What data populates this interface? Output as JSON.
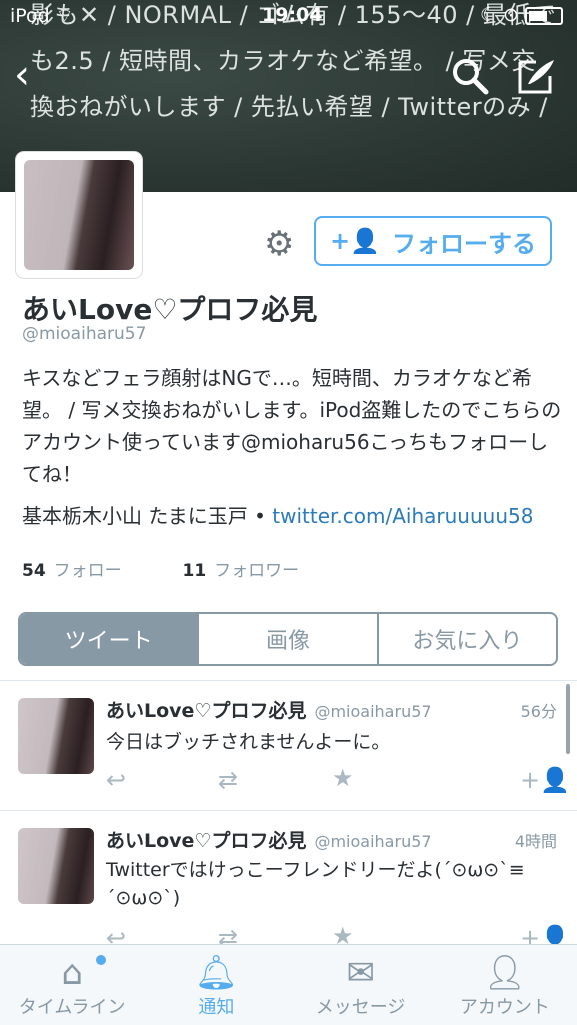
{
  "status_bar": {
    "carrier": "iPod",
    "time": "19:04"
  },
  "banner_lines": "影も✕ / NORMAL / ゴム有 / 155〜40 / 最低でも2.5 / 短時間、カラオケなど希望。 / 写メ交換おねがいします / 先払い希望 / Twitterのみ /",
  "profile": {
    "follow_label": "フォローする",
    "name": "あいLove♡プロフ必見",
    "handle": "@mioaiharu57",
    "bio": "キスなどフェラ顔射はNGで…。短時間、カラオケなど希望。 / 写メ交換おねがいします。iPod盗難したのでこちらのアカウント使っています@mioharu56こっちもフォローしてね！",
    "location": "基本栃木小山 たまに玉戸",
    "url": "twitter.com/Aiharuuuuu58",
    "following_count": "54",
    "following_label": "フォロー",
    "followers_count": "11",
    "followers_label": "フォロワー"
  },
  "tabs": [
    "ツイート",
    "画像",
    "お気に入り"
  ],
  "tweets": [
    {
      "name": "あいLove♡プロフ必見",
      "handle": "@mioaiharu57",
      "time": "56分",
      "text": "今日はブッチされませんよーに。"
    },
    {
      "name": "あいLove♡プロフ必見",
      "handle": "@mioaiharu57",
      "time": "4時間",
      "text": "Twitterではけっこーフレンドリーだよ(´⊙ω⊙`≡´⊙ω⊙`)"
    }
  ],
  "nav": [
    "タイムライン",
    "通知",
    "メッセージ",
    "アカウント"
  ],
  "colors": {
    "accent": "#55acee",
    "tab_active": "#8899a6",
    "link": "#2b7bb9"
  }
}
